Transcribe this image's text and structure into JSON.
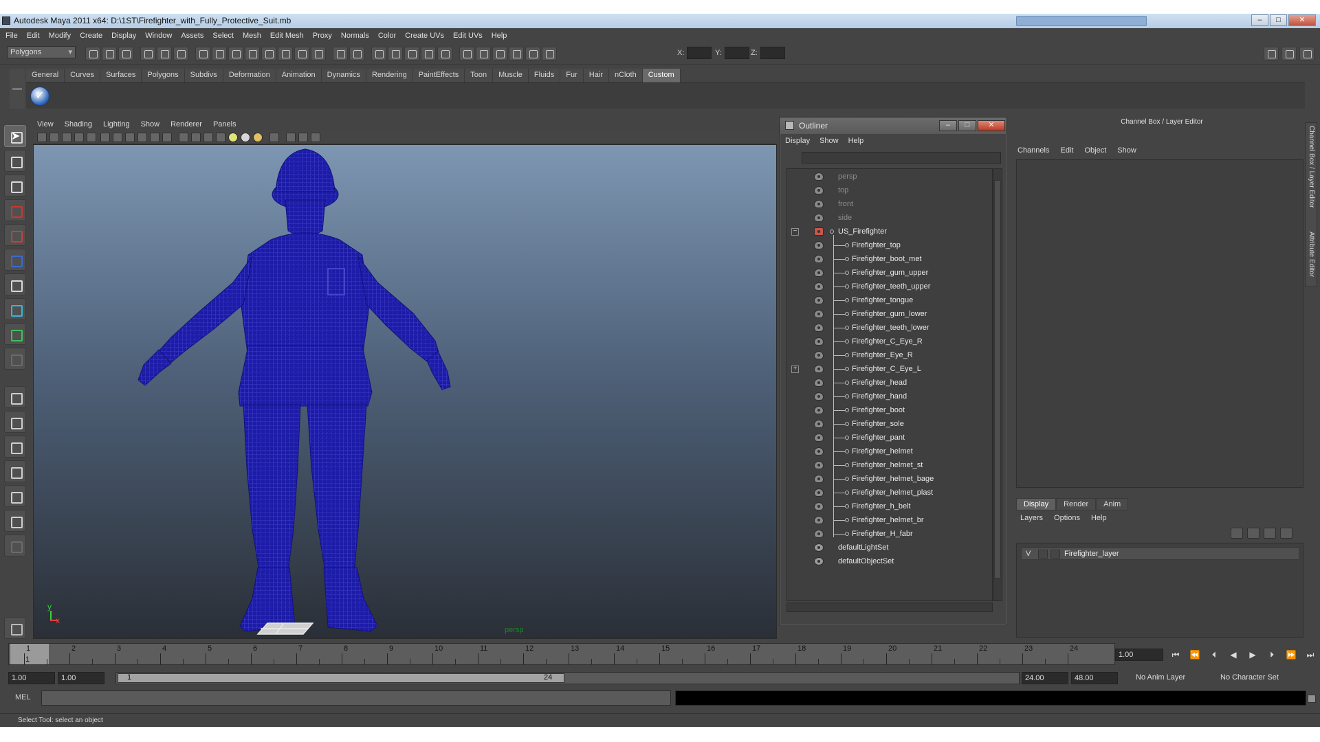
{
  "window": {
    "title": "Autodesk Maya 2011 x64: D:\\1ST\\Firefighter_with_Fully_Protective_Suit.mb",
    "minimize": "–",
    "maximize": "□",
    "close": "✕"
  },
  "menubar": [
    "File",
    "Edit",
    "Modify",
    "Create",
    "Display",
    "Window",
    "Assets",
    "Select",
    "Mesh",
    "Edit Mesh",
    "Proxy",
    "Normals",
    "Color",
    "Create UVs",
    "Edit UVs",
    "Help"
  ],
  "statusline": {
    "mode": "Polygons",
    "x_label": "X:",
    "y_label": "Y:",
    "z_label": "Z:"
  },
  "shelf": {
    "tabs": [
      "General",
      "Curves",
      "Surfaces",
      "Polygons",
      "Subdivs",
      "Deformation",
      "Animation",
      "Dynamics",
      "Rendering",
      "PaintEffects",
      "Toon",
      "Muscle",
      "Fluids",
      "Fur",
      "Hair",
      "nCloth",
      "Custom"
    ],
    "active_tab": "Custom",
    "button_glyph": "✓"
  },
  "viewport": {
    "menu": [
      "View",
      "Shading",
      "Lighting",
      "Show",
      "Renderer",
      "Panels"
    ],
    "camera": "persp",
    "axis_y": "y",
    "axis_x": "x",
    "wire_color": "#1a1aa6"
  },
  "outliner": {
    "title": "Outliner",
    "menu": [
      "Display",
      "Show",
      "Help"
    ],
    "items": [
      {
        "label": "persp",
        "kind": "camera",
        "dim": true
      },
      {
        "label": "top",
        "kind": "camera",
        "dim": true
      },
      {
        "label": "front",
        "kind": "camera",
        "dim": true
      },
      {
        "label": "side",
        "kind": "camera",
        "dim": true
      },
      {
        "label": "US_Firefighter",
        "kind": "group",
        "dim": false
      },
      {
        "label": "Firefighter_top",
        "kind": "child",
        "dim": false
      },
      {
        "label": "Firefighter_boot_met",
        "kind": "child",
        "dim": false
      },
      {
        "label": "Firefighter_gum_upper",
        "kind": "child",
        "dim": false
      },
      {
        "label": "Firefighter_teeth_upper",
        "kind": "child",
        "dim": false
      },
      {
        "label": "Firefighter_tongue",
        "kind": "child",
        "dim": false
      },
      {
        "label": "Firefighter_gum_lower",
        "kind": "child",
        "dim": false
      },
      {
        "label": "Firefighter_teeth_lower",
        "kind": "child",
        "dim": false
      },
      {
        "label": "Firefighter_C_Eye_R",
        "kind": "child",
        "dim": false
      },
      {
        "label": "Firefighter_Eye_R",
        "kind": "child",
        "dim": false
      },
      {
        "label": "Firefighter_C_Eye_L",
        "kind": "child",
        "dim": false
      },
      {
        "label": "Firefighter_head",
        "kind": "child",
        "dim": false
      },
      {
        "label": "Firefighter_hand",
        "kind": "child",
        "dim": false
      },
      {
        "label": "Firefighter_boot",
        "kind": "child",
        "dim": false
      },
      {
        "label": "Firefighter_sole",
        "kind": "child",
        "dim": false
      },
      {
        "label": "Firefighter_pant",
        "kind": "child",
        "dim": false
      },
      {
        "label": "Firefighter_helmet",
        "kind": "child",
        "dim": false
      },
      {
        "label": "Firefighter_helmet_st",
        "kind": "child",
        "dim": false
      },
      {
        "label": "Firefighter_helmet_bage",
        "kind": "child",
        "dim": false
      },
      {
        "label": "Firefighter_helmet_plast",
        "kind": "child",
        "dim": false
      },
      {
        "label": "Firefighter_h_belt",
        "kind": "child",
        "dim": false
      },
      {
        "label": "Firefighter_helmet_br",
        "kind": "child",
        "dim": false
      },
      {
        "label": "Firefighter_H_fabr",
        "kind": "child",
        "dim": false
      },
      {
        "label": "defaultLightSet",
        "kind": "set",
        "dim": false
      },
      {
        "label": "defaultObjectSet",
        "kind": "set",
        "dim": false
      }
    ],
    "collapse_glyph": "−",
    "expand_glyph": "+"
  },
  "channelbox": {
    "title": "Channel Box / Layer Editor",
    "menu": [
      "Channels",
      "Edit",
      "Object",
      "Show"
    ],
    "side_tab_1": "Channel Box / Layer Editor",
    "side_tab_2": "Attribute Editor"
  },
  "layer_editor": {
    "tabs": [
      "Display",
      "Render",
      "Anim"
    ],
    "active_tab": "Display",
    "menu": [
      "Layers",
      "Options",
      "Help"
    ],
    "layers": [
      {
        "visible": "V",
        "name": "Firefighter_layer"
      }
    ]
  },
  "timeline": {
    "start": 1,
    "end": 24,
    "current": "1",
    "current_field": "1.00",
    "playback_glyphs": [
      "⏮",
      "⏪",
      "⏴",
      "◀",
      "▶",
      "⏵",
      "⏩",
      "⏭"
    ]
  },
  "range": {
    "start_field": "1.00",
    "start_field_2": "1.00",
    "slider_start": "1",
    "slider_end": "24",
    "end_field": "24.00",
    "end_field_2": "48.00",
    "anim_layer": "No Anim Layer",
    "character_set": "No Character Set"
  },
  "mel": {
    "label": "MEL"
  },
  "helpline": "Select Tool: select an object"
}
